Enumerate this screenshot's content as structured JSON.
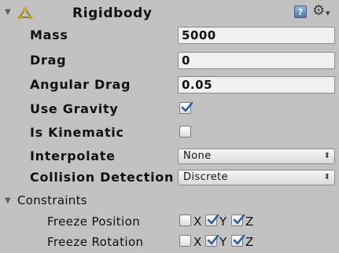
{
  "component": {
    "title": "Rigidbody",
    "help_icon": "help-book-icon",
    "help_glyph": "?",
    "settings_icon": "gear-icon"
  },
  "properties": {
    "mass": {
      "label": "Mass",
      "value": "5000"
    },
    "drag": {
      "label": "Drag",
      "value": "0"
    },
    "angular_drag": {
      "label": "Angular Drag",
      "value": "0.05"
    },
    "use_gravity": {
      "label": "Use Gravity",
      "checked": true
    },
    "is_kinematic": {
      "label": "Is Kinematic",
      "checked": false
    },
    "interpolate": {
      "label": "Interpolate",
      "value": "None"
    },
    "collision_detection": {
      "label": "Collision Detection",
      "value": "Discrete"
    }
  },
  "constraints": {
    "label": "Constraints",
    "freeze_position": {
      "label": "Freeze Position",
      "axes": [
        {
          "name": "X",
          "checked": false
        },
        {
          "name": "Y",
          "checked": true
        },
        {
          "name": "Z",
          "checked": true
        }
      ]
    },
    "freeze_rotation": {
      "label": "Freeze Rotation",
      "axes": [
        {
          "name": "X",
          "checked": false
        },
        {
          "name": "Y",
          "checked": true
        },
        {
          "name": "Z",
          "checked": true
        }
      ]
    }
  },
  "colors": {
    "panel_bg": "#c2c2c2",
    "check_blue": "#2a5fa8"
  }
}
